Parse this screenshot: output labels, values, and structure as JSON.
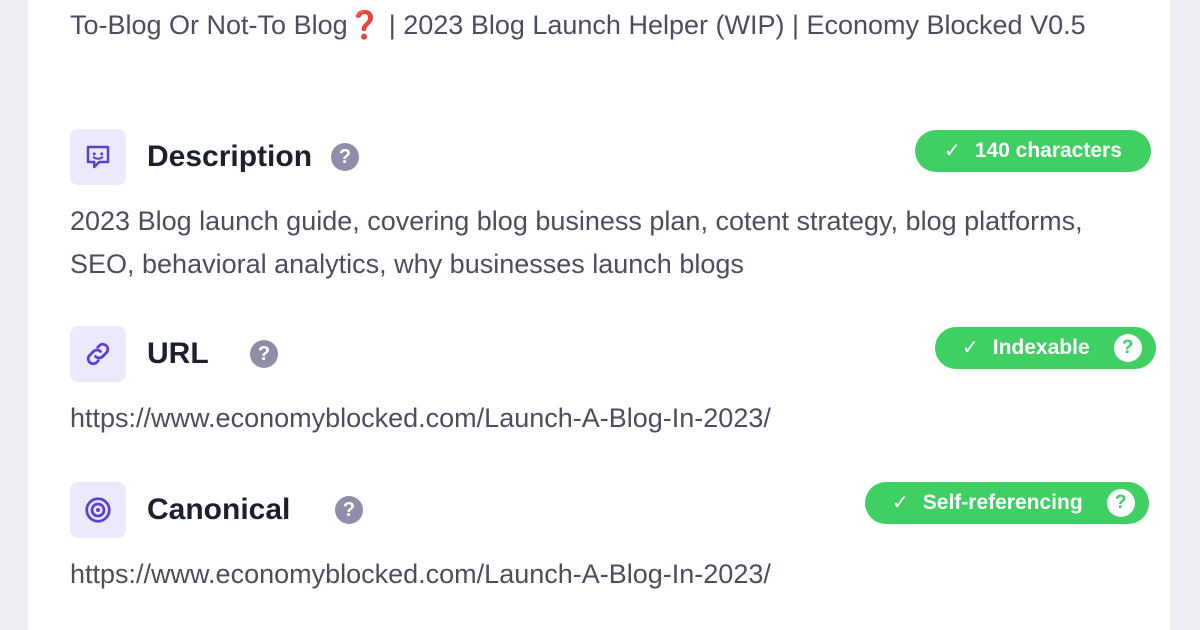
{
  "page": {
    "title_text": "To-Blog Or Not-To Blog",
    "title_mark": "❓",
    "title_rest": " | 2023 Blog Launch Helper (WIP) | Economy Blocked V0.5"
  },
  "description": {
    "label": "Description",
    "help": "?",
    "badge": "140 characters",
    "check": "✓",
    "text": "2023 Blog launch guide, covering blog business plan, cotent strategy, blog platforms, SEO, behavioral analytics, why businesses launch blogs",
    "icon": "speech-bubble-icon"
  },
  "url": {
    "label": "URL",
    "help": "?",
    "badge": "Indexable",
    "badge_help": "?",
    "check": "✓",
    "text": "https://www.economyblocked.com/Launch-A-Blog-In-2023/",
    "icon": "link-icon"
  },
  "canonical": {
    "label": "Canonical",
    "help": "?",
    "badge": "Self-referencing",
    "badge_help": "?",
    "check": "✓",
    "text": "https://www.economyblocked.com/Launch-A-Blog-In-2023/",
    "icon": "target-icon"
  },
  "colors": {
    "accent": "#5b3fd9",
    "badge_green": "#3fcf63",
    "icon_bg": "#ebe9fb",
    "help_grey": "#8d8fa8"
  }
}
